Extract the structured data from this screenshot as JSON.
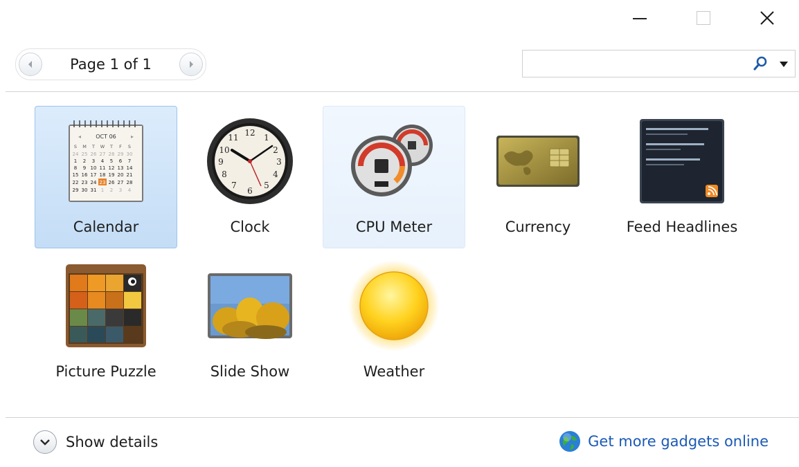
{
  "window": {
    "controls": {
      "minimize": "minimize-icon",
      "maximize": "maximize-icon",
      "close": "close-icon"
    }
  },
  "toolbar": {
    "page_label": "Page 1 of 1",
    "search_value": ""
  },
  "gadgets": [
    {
      "name": "Calendar",
      "icon": "calendar-icon",
      "state": "selected",
      "calendar_month": "OCT 06",
      "calendar_highlight_day": "23"
    },
    {
      "name": "Clock",
      "icon": "clock-icon",
      "state": "normal"
    },
    {
      "name": "CPU Meter",
      "icon": "cpu-meter-icon",
      "state": "hover"
    },
    {
      "name": "Currency",
      "icon": "currency-icon",
      "state": "normal"
    },
    {
      "name": "Feed Headlines",
      "icon": "feed-headlines-icon",
      "state": "normal"
    },
    {
      "name": "Picture Puzzle",
      "icon": "picture-puzzle-icon",
      "state": "normal"
    },
    {
      "name": "Slide Show",
      "icon": "slide-show-icon",
      "state": "normal"
    },
    {
      "name": "Weather",
      "icon": "weather-icon",
      "state": "normal"
    }
  ],
  "footer": {
    "show_details_label": "Show details",
    "get_more_label": "Get more gadgets online"
  },
  "colors": {
    "selected_bg": "#c4ddf6",
    "hover_bg": "#e7f1fc",
    "link": "#1c59b5"
  }
}
